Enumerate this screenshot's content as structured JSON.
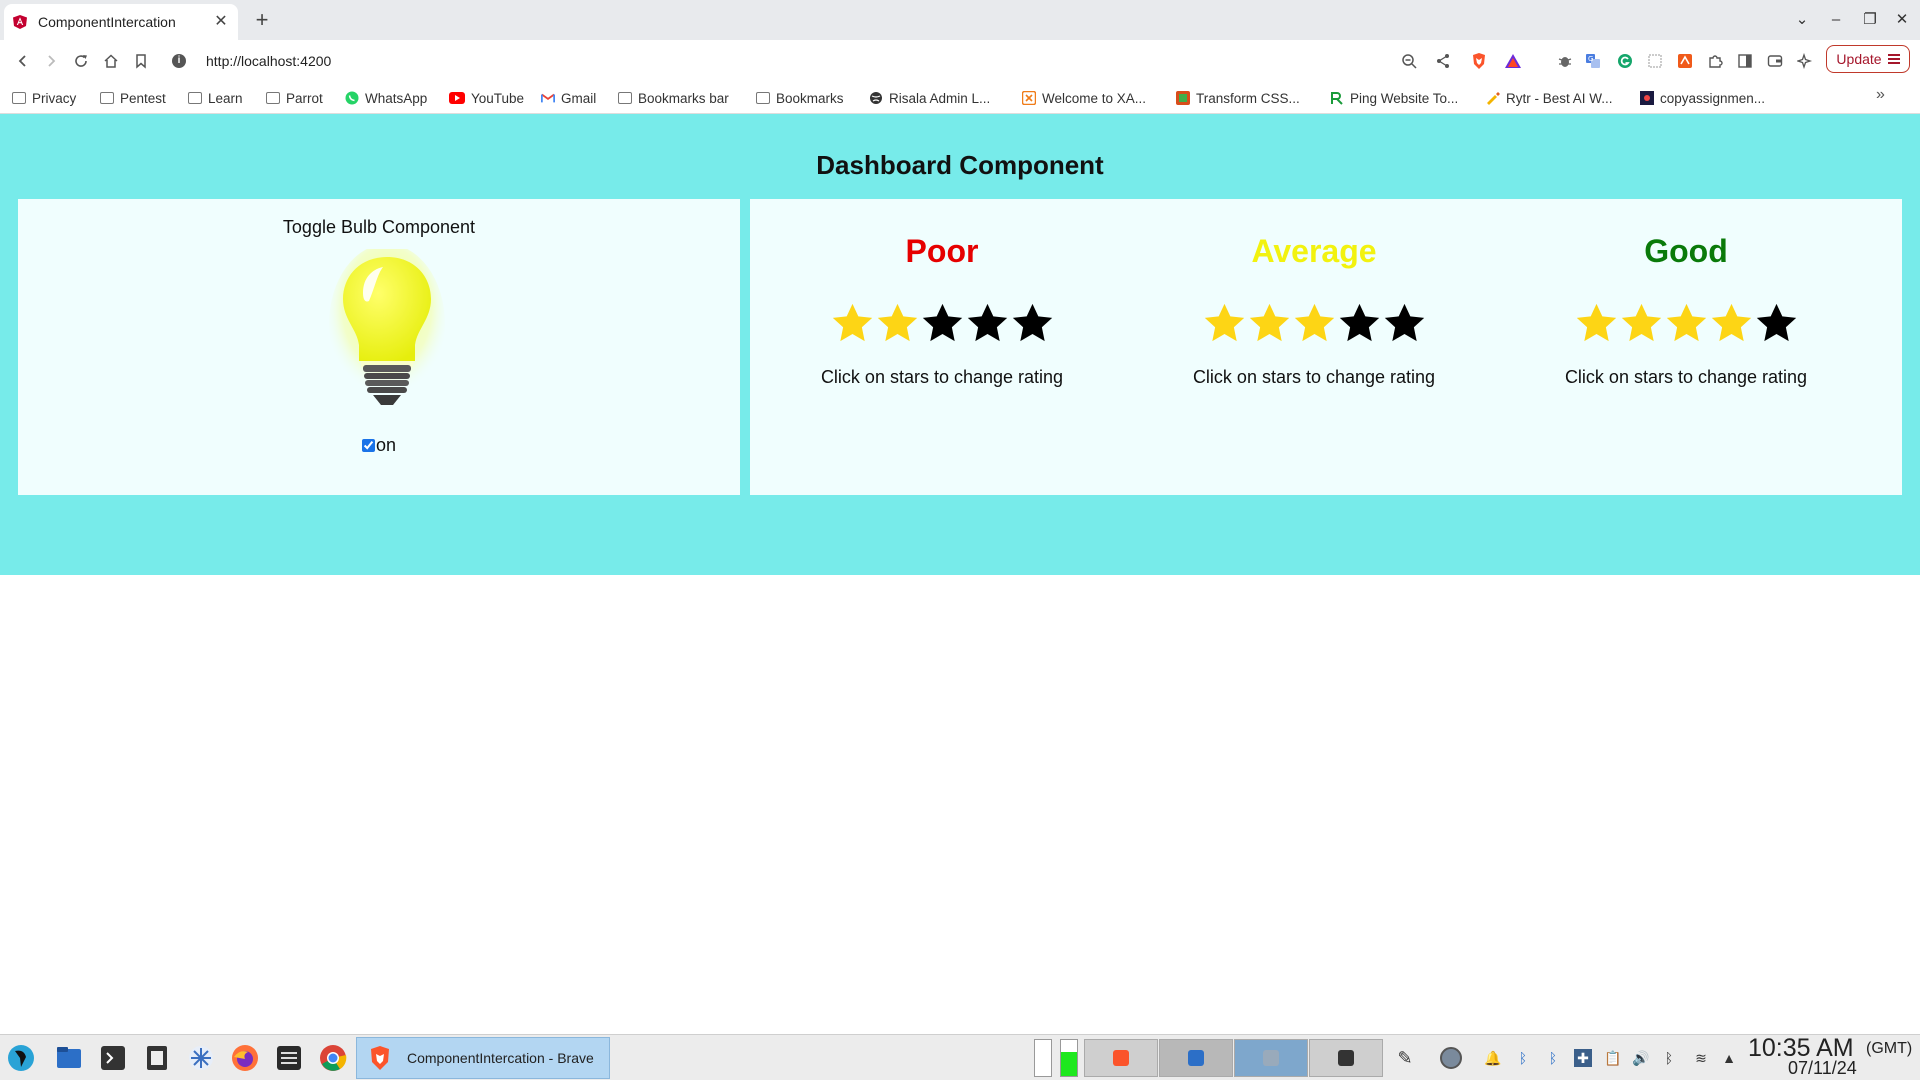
{
  "browser": {
    "tab_title": "ComponentIntercation",
    "new_tab": "+",
    "url": "http://localhost:4200",
    "update_label": "Update"
  },
  "bookmarks": [
    {
      "label": "Privacy",
      "icon": "folder-icon"
    },
    {
      "label": "Pentest",
      "icon": "folder-icon"
    },
    {
      "label": "Learn",
      "icon": "folder-icon"
    },
    {
      "label": "Parrot",
      "icon": "folder-icon"
    },
    {
      "label": "WhatsApp",
      "icon": "whatsapp-icon"
    },
    {
      "label": "YouTube",
      "icon": "youtube-icon"
    },
    {
      "label": "Gmail",
      "icon": "gmail-icon"
    },
    {
      "label": "Bookmarks bar",
      "icon": "folder-icon"
    },
    {
      "label": "Bookmarks",
      "icon": "folder-icon"
    },
    {
      "label": "Risala Admin L...",
      "icon": "globe-icon"
    },
    {
      "label": "Welcome to XA...",
      "icon": "xampp-icon"
    },
    {
      "label": "Transform CSS...",
      "icon": "css-icon"
    },
    {
      "label": "Ping Website To...",
      "icon": "ping-icon"
    },
    {
      "label": "Rytr - Best AI W...",
      "icon": "rytr-icon"
    },
    {
      "label": "copyassignmen...",
      "icon": "site-icon"
    }
  ],
  "dashboard": {
    "title": "Dashboard Component",
    "bulb": {
      "heading": "Toggle Bulb Component",
      "checked": true,
      "toggle_label": "on"
    },
    "ratings": [
      {
        "label": "Poor",
        "color": "#e60000",
        "value": 2,
        "max": 5,
        "hint": "Click on stars to change rating"
      },
      {
        "label": "Average",
        "color": "#f2f20f",
        "value": 3,
        "max": 5,
        "hint": "Click on stars to change rating"
      },
      {
        "label": "Good",
        "color": "#0a7a0a",
        "value": 4,
        "max": 5,
        "hint": "Click on stars to change rating"
      }
    ],
    "star_filled_color": "#fdd515",
    "star_empty_color": "#000000"
  },
  "taskbar": {
    "active_window": "ComponentIntercation - Brave",
    "time": "10:35 AM",
    "timezone": "(GMT)",
    "date": "07/11/24"
  }
}
